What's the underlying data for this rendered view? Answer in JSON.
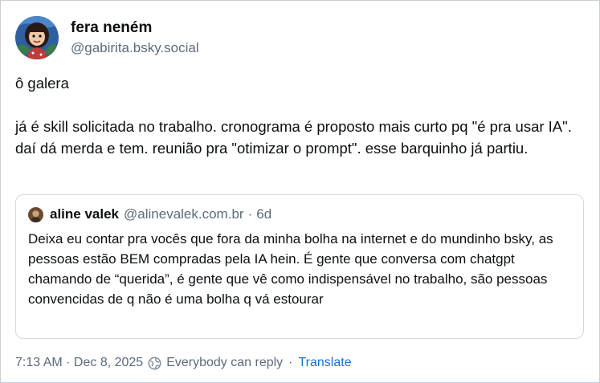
{
  "post": {
    "author": {
      "display_name": "fera neném",
      "handle": "@gabirita.bsky.social",
      "avatar_icon": "cartoon-avatar"
    },
    "paragraphs": [
      "ô galera",
      "já é skill solicitada no trabalho. cronograma é proposto mais curto pq \"é pra usar IA\". daí dá merda e tem. reunião pra \"otimizar o prompt\". esse barquinho já partiu."
    ],
    "quote": {
      "display_name": "aline valek",
      "handle": "@alinevalek.com.br",
      "separator": "·",
      "time": "6d",
      "text": "Deixa eu contar pra vocês que fora da minha bolha na internet e do mundinho bsky, as pessoas estão BEM compradas pela IA hein. É gente que conversa com chatgpt chamando de “querida”, é gente que vê como indispensável no trabalho, são pessoas convencidas de q não é uma bolha q vá estourar"
    },
    "footer": {
      "timestamp": "7:13 AM · Dec 8, 2025",
      "reply_setting": "Everybody can reply",
      "separator": "·",
      "translate": "Translate"
    }
  },
  "colors": {
    "text": "#0b0f14",
    "muted": "#5b6b7c",
    "link": "#1a6dd6",
    "border": "#d4d9de"
  }
}
